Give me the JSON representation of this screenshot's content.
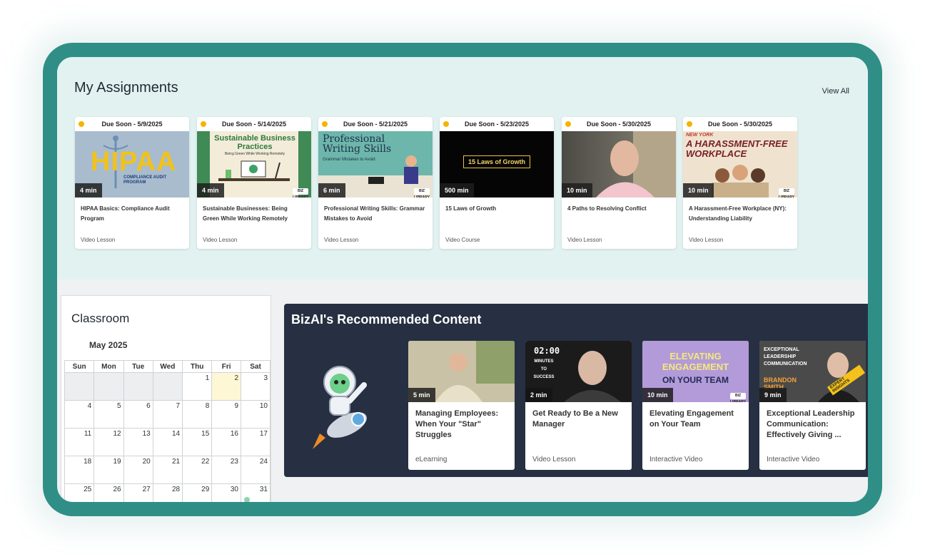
{
  "assignments": {
    "title": "My Assignments",
    "view_all": "View All",
    "cards": [
      {
        "due": "Due Soon - 5/9/2025",
        "duration": "4 min",
        "title": "HIPAA Basics: Compliance Audit Program",
        "type": "Video Lesson",
        "thumb_text": "HIPAA",
        "thumb_sub": "COMPLIANCE AUDIT PROGRAM"
      },
      {
        "due": "Due Soon - 5/14/2025",
        "duration": "4 min",
        "title": "Sustainable Businesses: Being Green While Working Remotely",
        "type": "Video Lesson",
        "thumb_text": "Sustainable Business Practices",
        "thumb_sub": "Being Green While Working Remotely"
      },
      {
        "due": "Due Soon - 5/21/2025",
        "duration": "6 min",
        "title": "Professional Writing Skills: Grammar Mistakes to Avoid",
        "type": "Video Lesson",
        "thumb_text": "Professional Writing Skills",
        "thumb_sub": "Grammar Mistakes to Avoid"
      },
      {
        "due": "Due Soon - 5/23/2025",
        "duration": "500 min",
        "title": "15 Laws of Growth",
        "type": "Video Course",
        "thumb_text": "15 Laws of Growth"
      },
      {
        "due": "Due Soon - 5/30/2025",
        "duration": "10 min",
        "title": "4 Paths to Resolving Conflict",
        "type": "Video Lesson"
      },
      {
        "due": "Due Soon - 5/30/2025",
        "duration": "10 min",
        "title": "A Harassment-Free Workplace (NY): Understanding Liability",
        "type": "Video Lesson",
        "thumb_text": "A HARASSMENT-FREE WORKPLACE",
        "thumb_sub": "NEW YORK"
      }
    ],
    "badge_text": "BIZ LIBRARY"
  },
  "classroom": {
    "title": "Classroom",
    "month": "May 2025",
    "days": [
      "Sun",
      "Mon",
      "Tue",
      "Wed",
      "Thu",
      "Fri",
      "Sat"
    ],
    "weeks": [
      [
        "",
        "",
        "",
        "",
        "1",
        "2",
        "3"
      ],
      [
        "4",
        "5",
        "6",
        "7",
        "8",
        "9",
        "10"
      ],
      [
        "11",
        "12",
        "13",
        "14",
        "15",
        "16",
        "17"
      ],
      [
        "18",
        "19",
        "20",
        "21",
        "22",
        "23",
        "24"
      ],
      [
        "25",
        "26",
        "27",
        "28",
        "29",
        "30",
        "31"
      ]
    ],
    "today": "2"
  },
  "recommended": {
    "title": "BizAI's Recommended Content",
    "cards": [
      {
        "duration": "5 min",
        "title": "Managing Employees: When Your \"Star\" Struggles",
        "type": "eLearning"
      },
      {
        "duration": "2 min",
        "title": "Get Ready to Be a New Manager",
        "type": "Video Lesson",
        "thumb_clock": "02:00",
        "thumb_text": "MINUTES TO SUCCESS"
      },
      {
        "duration": "10 min",
        "title": "Elevating Engagement on Your Team",
        "type": "Interactive Video",
        "thumb_text": "ELEVATING ENGAGEMENT",
        "thumb_sub": "ON YOUR TEAM"
      },
      {
        "duration": "9 min",
        "title": "Exceptional Leadership Communication: Effectively Giving ...",
        "type": "Interactive Video",
        "thumb_text": "EXCEPTIONAL LEADERSHIP COMMUNICATION",
        "thumb_sub": "BRANDON SMITH",
        "thumb_tag": "EXPERT INSIGHTS"
      }
    ]
  },
  "colors": {
    "frame": "#2f8f86",
    "assign_bg": "#e2f2f1",
    "due_dot": "#f4b400",
    "rec_bg": "#263042"
  }
}
